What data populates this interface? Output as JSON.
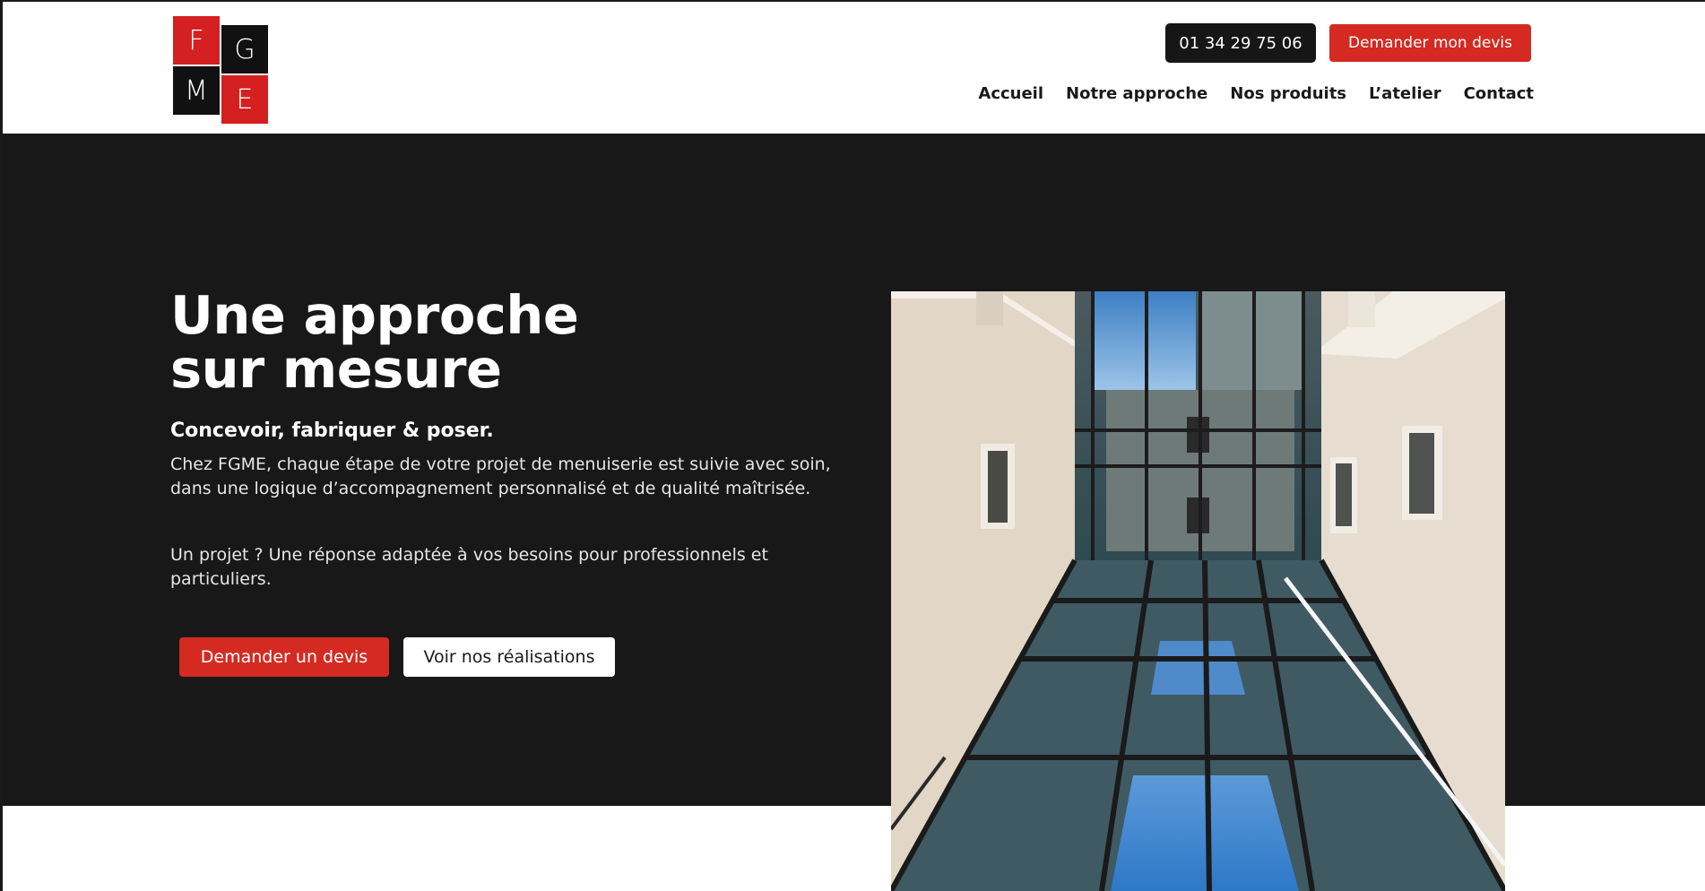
{
  "header": {
    "logo": {
      "letters": [
        "F",
        "G",
        "M",
        "E"
      ],
      "colors": {
        "red": "#d42020",
        "black": "#111111"
      }
    },
    "phone_label": "01 34 29 75 06",
    "quote_button_label": "Demander mon devis",
    "nav": [
      {
        "label": "Accueil"
      },
      {
        "label": "Notre approche"
      },
      {
        "label": "Nos produits"
      },
      {
        "label": "L’atelier"
      },
      {
        "label": "Contact"
      }
    ]
  },
  "hero": {
    "title_line1": "Une approche",
    "title_line2": "sur mesure",
    "subtitle": "Concevoir, fabriquer & poser.",
    "paragraph1": "Chez FGME, chaque étape de votre projet de menuiserie est suivie avec soin, dans une logique d’accompagnement personnalisé et de qualité maîtrisée.",
    "paragraph2": "Un projet ? Une réponse adaptée à vos besoins pour professionnels et particuliers.",
    "primary_cta": "Demander un devis",
    "secondary_cta": "Voir nos réalisations",
    "image": {
      "icon": "courtyard-glass-roof-photo"
    }
  },
  "colors": {
    "accent": "#d42a22",
    "dark": "#181818",
    "background": "#ffffff"
  }
}
